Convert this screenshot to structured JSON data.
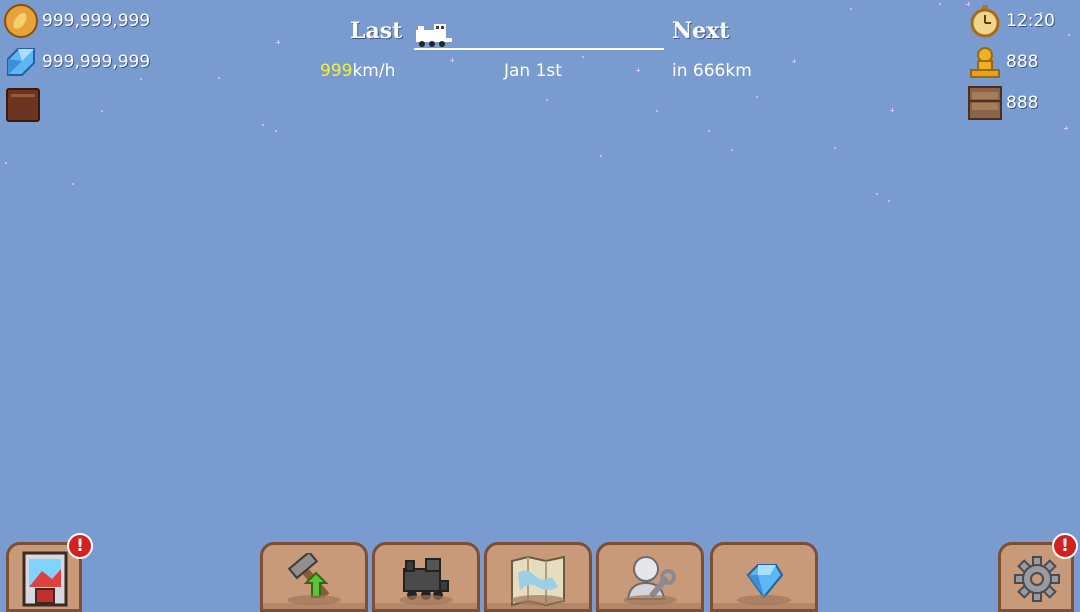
{
  "currencies": {
    "coins": "999,999,999",
    "gems": "999,999,999"
  },
  "status": {
    "clock": "12:20",
    "passengers": "888",
    "cargo": "888"
  },
  "journey": {
    "last_label": "Last",
    "next_label": "Next",
    "speed_value": "999",
    "speed_unit": "km/h",
    "date": "Jan 1st",
    "distance_next": "in 666km"
  },
  "alerts": {
    "shop": "!",
    "settings": "!"
  },
  "toolbar": {
    "buttons": [
      "hammer-upgrade-icon",
      "train-icon",
      "map-icon",
      "worker-icon",
      "gem-icon"
    ]
  },
  "colors": {
    "sky": "#7a9bd0",
    "panel": "#c89a7a",
    "panel_border": "#7a4f36",
    "speed_highlight": "#f2f23c",
    "alert": "#d61f1f"
  }
}
